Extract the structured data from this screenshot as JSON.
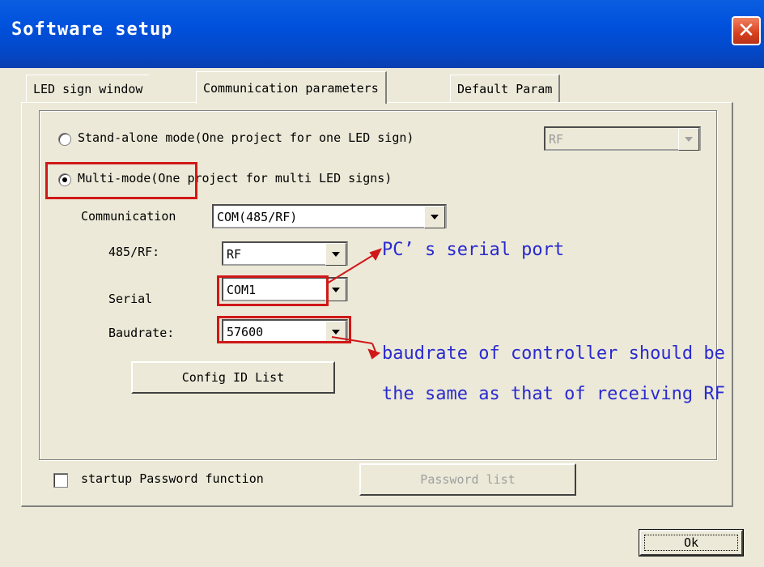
{
  "window": {
    "title": "Software setup",
    "close_glyph": "✕",
    "close_icon": "close-icon"
  },
  "tabs": [
    {
      "label": "LED sign window",
      "active": false
    },
    {
      "label": "Communication parameters",
      "active": true
    },
    {
      "label": "Default Param",
      "active": false
    }
  ],
  "mode": {
    "standalone_label": "Stand-alone mode(One project for one LED sign)",
    "standalone_selected": false,
    "standalone_combo_value": "RF",
    "multi_label": "Multi-mode(One project for multi LED signs)",
    "multi_selected": true
  },
  "communication": {
    "label": "Communication",
    "value": "COM(485/RF)"
  },
  "rs485_rf": {
    "label": "485/RF:",
    "value": "RF"
  },
  "serial": {
    "label": "Serial",
    "value": "COM1"
  },
  "baudrate": {
    "label": "Baudrate:",
    "value": "57600"
  },
  "config_button": "Config ID List",
  "password": {
    "checkbox_label": "startup Password function",
    "checked": false,
    "list_button": "Password list"
  },
  "ok_button": "Ok",
  "annotations": {
    "serial_note": "PC’ s serial port",
    "baud_note_line1": "baudrate of controller should be",
    "baud_note_line2": "the same as that of receiving RF",
    "highlight_color": "#d01818",
    "note_color": "#2a2ad0"
  }
}
